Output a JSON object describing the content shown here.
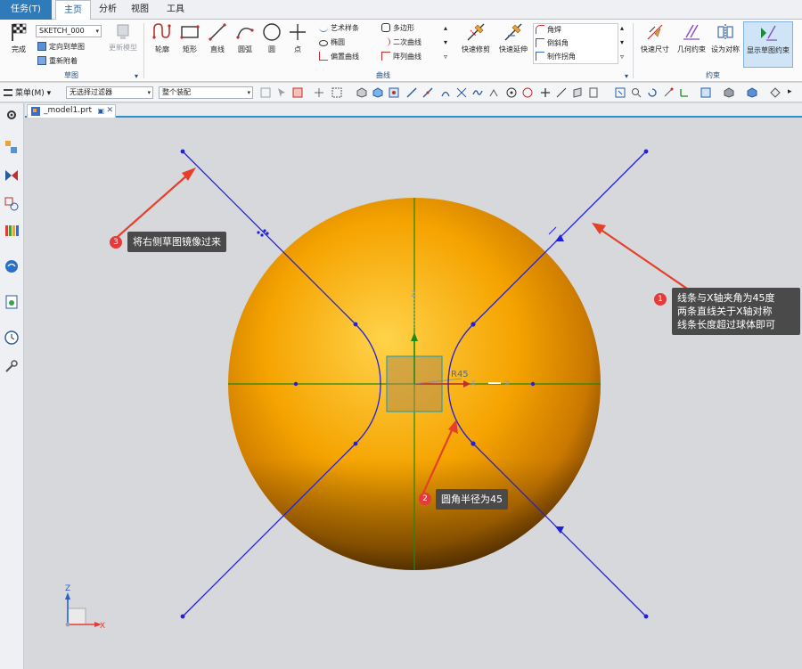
{
  "menu_tabs": {
    "task": "任务(T)",
    "home": "主页",
    "analysis": "分析",
    "view": "视图",
    "tools": "工具"
  },
  "ribbon": {
    "finish_label": "完成",
    "sketch_name": "SKETCH_000",
    "orient_to_sketch": "定向到草图",
    "reattach": "重新附着",
    "update_model": "更新模型",
    "sketch_group": "草图",
    "curve_tools": {
      "profile": "轮廓",
      "rectangle": "矩形",
      "line": "直线",
      "arc": "圆弧",
      "circle": "圆",
      "point": "点"
    },
    "curve_small": {
      "studio_spline": "艺术样条",
      "ellipse": "椭圆",
      "offset_curve": "偏置曲线",
      "polygon": "多边形",
      "conic": "二次曲线",
      "pattern_curve": "阵列曲线"
    },
    "curve_group": "曲线",
    "quick_trim": "快速修剪",
    "quick_extend": "快速延伸",
    "fillet": "角焊",
    "chamfer": "倒斜角",
    "make_corner": "制作拐角",
    "rapid_dimension": "快速尺寸",
    "geometric_constraints": "几何约束",
    "make_symmetric": "设为对称",
    "show_sketch_constraints": "显示草图约束",
    "constraints_group": "约束"
  },
  "toolbar2": {
    "menu_label": "菜单(M)",
    "filter_value": "无选择过滤器",
    "assembly_value": "整个装配"
  },
  "document": {
    "tab_label": "_model1.prt"
  },
  "viewport": {
    "dimension_label": "R45",
    "axis_x": "X",
    "axis_z": "Z",
    "triad_x": "X",
    "triad_z": "Z"
  },
  "callouts": [
    {
      "num": "1",
      "lines": [
        "线条与X轴夹角为45度",
        "两条直线关于X轴对称",
        "线条长度超过球体即可"
      ]
    },
    {
      "num": "2",
      "lines": [
        "圆角半径为45"
      ]
    },
    {
      "num": "3",
      "lines": [
        "将右侧草图镜像过来"
      ]
    }
  ],
  "colors": {
    "sketch_line": "#2020e0",
    "axis_green": "#1a8a1a",
    "callout_bg": "#4a4a4a",
    "callout_badge": "#e53a3a",
    "arrow_red": "#e5402a",
    "sphere_orange": "#f5a300"
  }
}
